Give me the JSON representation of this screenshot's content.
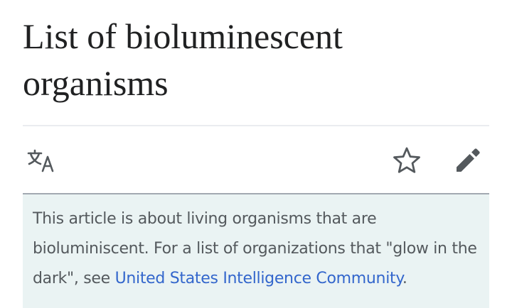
{
  "page": {
    "title": "List of bioluminescent organisms"
  },
  "toolbar": {
    "language_icon": "translate-icon",
    "watch_icon": "star-outline-icon",
    "edit_icon": "pencil-icon"
  },
  "hatnote": {
    "text_before": "This article is about living organisms that are bioluminiscent. For a list of organizations that \"glow in the dark\", see ",
    "link_text": "United States Intelligence Community",
    "text_after": "."
  },
  "colors": {
    "text": "#202122",
    "hatnote_text": "#54595d",
    "hatnote_background": "#eaf3f3",
    "link": "#3366cc",
    "icon": "#54595d"
  }
}
